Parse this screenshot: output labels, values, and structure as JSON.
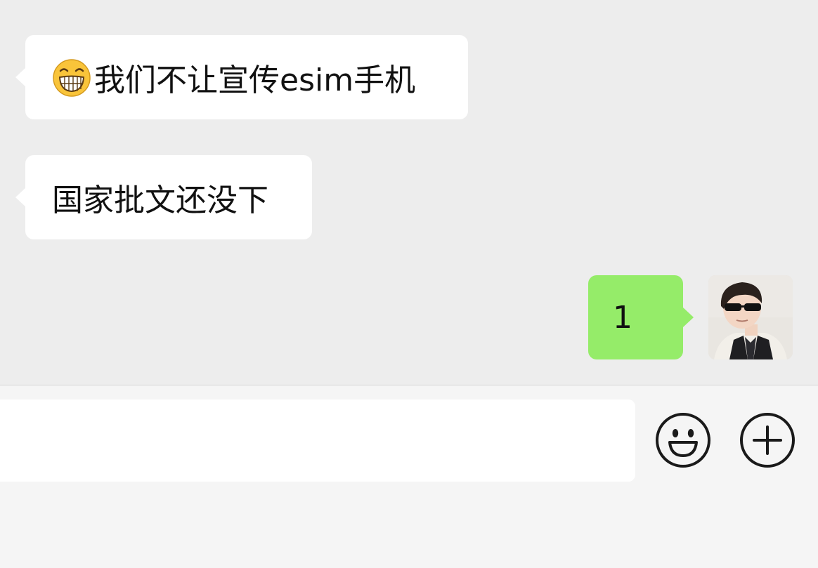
{
  "messages": [
    {
      "side": "left",
      "text": "我们不让宣传esim手机",
      "prefix_emoji": "grinning-face-emoji"
    },
    {
      "side": "left",
      "text": "国家批文还没下"
    },
    {
      "side": "right",
      "text": "1"
    }
  ],
  "input": {
    "value": "",
    "placeholder": ""
  },
  "icons": {
    "emoji_button": "smiley-face-icon",
    "more_button": "plus-circle-icon"
  },
  "colors": {
    "chat_background": "#ededed",
    "incoming_bubble": "#ffffff",
    "outgoing_bubble": "#95ec69",
    "input_bar_background": "#f5f5f5",
    "icon_stroke": "#1a1a1a"
  }
}
